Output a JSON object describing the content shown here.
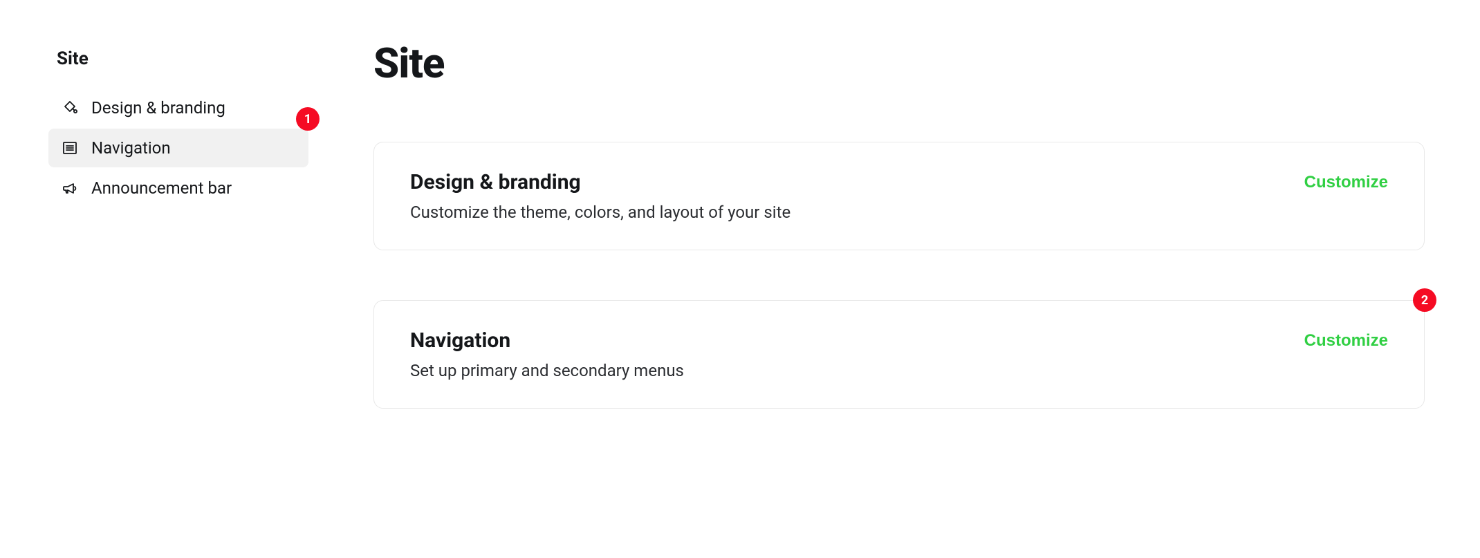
{
  "sidebar": {
    "title": "Site",
    "items": [
      {
        "label": "Design & branding"
      },
      {
        "label": "Navigation"
      },
      {
        "label": "Announcement bar"
      }
    ],
    "badge1": "1"
  },
  "main": {
    "title": "Site",
    "cards": [
      {
        "title": "Design & branding",
        "desc": "Customize the theme, colors, and layout of your site",
        "action": "Customize"
      },
      {
        "title": "Navigation",
        "desc": "Set up primary and secondary menus",
        "action": "Customize",
        "badge": "2"
      }
    ]
  }
}
